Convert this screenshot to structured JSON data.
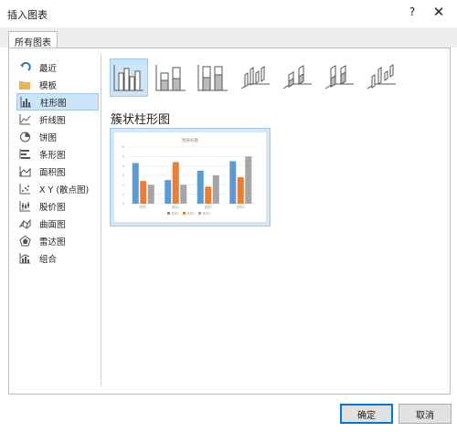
{
  "dialog": {
    "title": "插入图表",
    "help_label": "?",
    "close_label": "✕"
  },
  "tabs": [
    {
      "label": "所有图表"
    }
  ],
  "sidebar": {
    "selected_index": 2,
    "items": [
      {
        "label": "最近",
        "icon": "recent-icon"
      },
      {
        "label": "模板",
        "icon": "folder-icon"
      },
      {
        "label": "柱形图",
        "icon": "column-chart-icon"
      },
      {
        "label": "折线图",
        "icon": "line-chart-icon"
      },
      {
        "label": "饼图",
        "icon": "pie-chart-icon"
      },
      {
        "label": "条形图",
        "icon": "bar-chart-icon"
      },
      {
        "label": "面积图",
        "icon": "area-chart-icon"
      },
      {
        "label": "X Y (散点图)",
        "icon": "scatter-chart-icon"
      },
      {
        "label": "股价图",
        "icon": "stock-chart-icon"
      },
      {
        "label": "曲面图",
        "icon": "surface-chart-icon"
      },
      {
        "label": "雷达图",
        "icon": "radar-chart-icon"
      },
      {
        "label": "组合",
        "icon": "combo-chart-icon"
      }
    ]
  },
  "variants": {
    "selected_index": 0,
    "items": [
      {
        "icon": "clustered-column-icon"
      },
      {
        "icon": "stacked-column-icon"
      },
      {
        "icon": "100-stacked-column-icon"
      },
      {
        "icon": "3d-clustered-column-icon"
      },
      {
        "icon": "3d-stacked-column-icon"
      },
      {
        "icon": "3d-100-stacked-column-icon"
      },
      {
        "icon": "3d-column-icon"
      }
    ]
  },
  "selected_chart": {
    "name": "簇状柱形图"
  },
  "colors": {
    "selection_bg": "#cce4f7",
    "series1": "#5b9bd5",
    "series2": "#ed7d31",
    "series3": "#a5a5a5",
    "ok_border": "#0078d7"
  },
  "chart_data": {
    "type": "bar",
    "title": "图表标题",
    "categories": [
      "类别1",
      "类别2",
      "类别3",
      "类别4"
    ],
    "series": [
      {
        "name": "系列1",
        "values": [
          4.3,
          2.5,
          3.5,
          4.5
        ]
      },
      {
        "name": "系列2",
        "values": [
          2.4,
          4.4,
          1.8,
          2.8
        ]
      },
      {
        "name": "系列3",
        "values": [
          2.0,
          2.0,
          3.0,
          5.0
        ]
      }
    ],
    "ylim": [
      0,
      6
    ],
    "y_ticks": [
      0,
      1,
      2,
      3,
      4,
      5,
      6
    ],
    "grid": true,
    "legend": "bottom"
  },
  "buttons": {
    "ok": "确定",
    "cancel": "取消"
  }
}
